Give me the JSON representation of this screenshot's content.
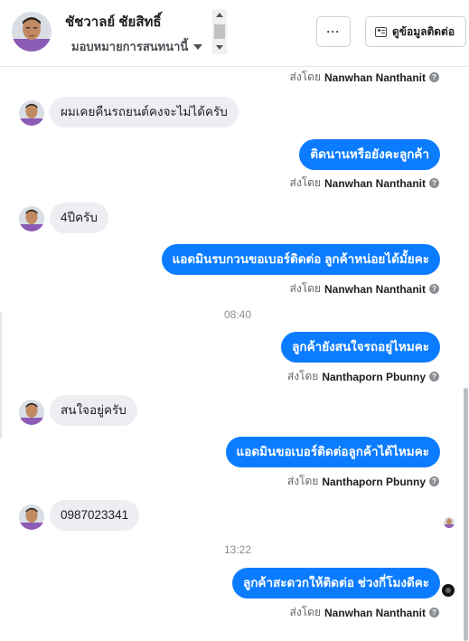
{
  "header": {
    "contact_name": "ชัชวาลย์ ชัยสิทธิ์",
    "assign_label": "มอบหมายการสนทนานี้",
    "more_label": "···",
    "contact_info_label": "ดูข้อมูลติดต่อ"
  },
  "sent_by_prefix": "ส่งโดย",
  "help_glyph": "?",
  "messages": [
    {
      "dir": "meta",
      "agent": "Nanwhan Nanthanit"
    },
    {
      "dir": "in",
      "text": "ผมเคยคืนรถยนต์คงจะไม่ได้ครับ"
    },
    {
      "dir": "out",
      "text": "ติดนานหรือยังคะลูกค้า",
      "agent": "Nanwhan Nanthanit"
    },
    {
      "dir": "in",
      "text": "4ปีครับ"
    },
    {
      "dir": "out",
      "text": "แอดมินรบกวนขอเบอร์ติดต่อ ลูกค้าหน่อยได้มั้ยคะ",
      "agent": "Nanwhan Nanthanit"
    },
    {
      "dir": "time",
      "text": "08:40"
    },
    {
      "dir": "out",
      "text": "ลูกค้ายังสนใจรถอยู่ไหมคะ",
      "agent": "Nanthaporn Pbunny"
    },
    {
      "dir": "in",
      "text": "สนใจอยู่ครับ"
    },
    {
      "dir": "out",
      "text": "แอดมินขอเบอร์ติดต่อลูกค้าได้ไหมคะ",
      "agent": "Nanthaporn Pbunny"
    },
    {
      "dir": "in",
      "text": "0987023341"
    },
    {
      "dir": "time",
      "text": "13:22"
    },
    {
      "dir": "out",
      "text": "ลูกค้าสะดวกให้ติดต่อ ช่วงกี่โมงดีคะ",
      "agent": "Nanwhan Nanthanit"
    }
  ],
  "colors": {
    "outgoing_bubble": "#0b7cff",
    "incoming_bubble": "#eceef1",
    "agent_name": "#1c1e21",
    "muted": "#65676b"
  }
}
